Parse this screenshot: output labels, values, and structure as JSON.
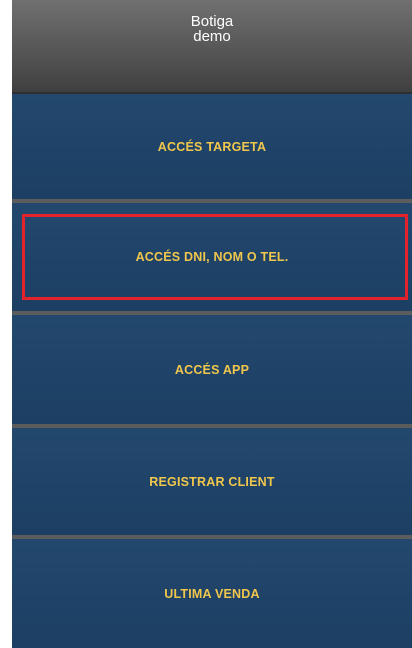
{
  "header": {
    "store_line1": "Botiga",
    "store_line2": "demo"
  },
  "menu": {
    "items": [
      {
        "label": "ACCÉS TARGETA"
      },
      {
        "label": "ACCÉS DNI, NOM O TEL.",
        "highlighted": true
      },
      {
        "label": "ACCÉS APP"
      },
      {
        "label": "REGISTRAR CLIENT"
      },
      {
        "label": "ULTIMA VENDA"
      }
    ]
  },
  "colors": {
    "button_bg": "#1f4468",
    "button_text": "#f0c64c",
    "header_bg": "#5a5a5a",
    "highlight_border": "#e3222c"
  }
}
